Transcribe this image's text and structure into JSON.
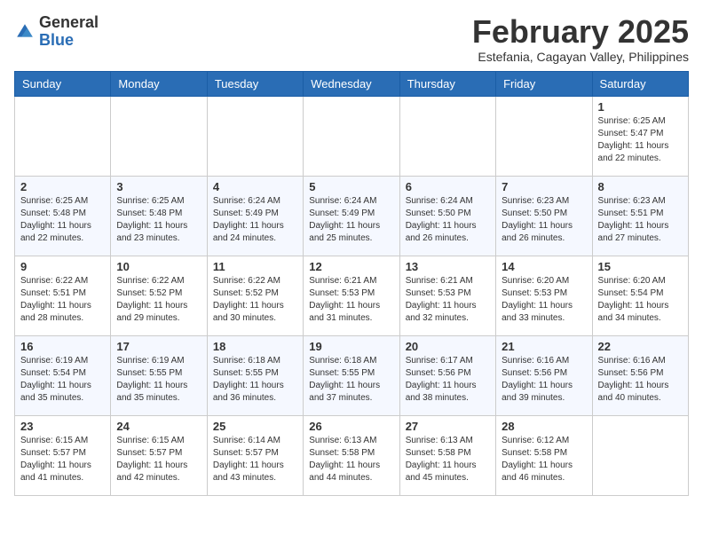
{
  "header": {
    "logo_general": "General",
    "logo_blue": "Blue",
    "month_year": "February 2025",
    "location": "Estefania, Cagayan Valley, Philippines"
  },
  "days_of_week": [
    "Sunday",
    "Monday",
    "Tuesday",
    "Wednesday",
    "Thursday",
    "Friday",
    "Saturday"
  ],
  "weeks": [
    [
      {
        "day": "",
        "info": ""
      },
      {
        "day": "",
        "info": ""
      },
      {
        "day": "",
        "info": ""
      },
      {
        "day": "",
        "info": ""
      },
      {
        "day": "",
        "info": ""
      },
      {
        "day": "",
        "info": ""
      },
      {
        "day": "1",
        "info": "Sunrise: 6:25 AM\nSunset: 5:47 PM\nDaylight: 11 hours\nand 22 minutes."
      }
    ],
    [
      {
        "day": "2",
        "info": "Sunrise: 6:25 AM\nSunset: 5:48 PM\nDaylight: 11 hours\nand 22 minutes."
      },
      {
        "day": "3",
        "info": "Sunrise: 6:25 AM\nSunset: 5:48 PM\nDaylight: 11 hours\nand 23 minutes."
      },
      {
        "day": "4",
        "info": "Sunrise: 6:24 AM\nSunset: 5:49 PM\nDaylight: 11 hours\nand 24 minutes."
      },
      {
        "day": "5",
        "info": "Sunrise: 6:24 AM\nSunset: 5:49 PM\nDaylight: 11 hours\nand 25 minutes."
      },
      {
        "day": "6",
        "info": "Sunrise: 6:24 AM\nSunset: 5:50 PM\nDaylight: 11 hours\nand 26 minutes."
      },
      {
        "day": "7",
        "info": "Sunrise: 6:23 AM\nSunset: 5:50 PM\nDaylight: 11 hours\nand 26 minutes."
      },
      {
        "day": "8",
        "info": "Sunrise: 6:23 AM\nSunset: 5:51 PM\nDaylight: 11 hours\nand 27 minutes."
      }
    ],
    [
      {
        "day": "9",
        "info": "Sunrise: 6:22 AM\nSunset: 5:51 PM\nDaylight: 11 hours\nand 28 minutes."
      },
      {
        "day": "10",
        "info": "Sunrise: 6:22 AM\nSunset: 5:52 PM\nDaylight: 11 hours\nand 29 minutes."
      },
      {
        "day": "11",
        "info": "Sunrise: 6:22 AM\nSunset: 5:52 PM\nDaylight: 11 hours\nand 30 minutes."
      },
      {
        "day": "12",
        "info": "Sunrise: 6:21 AM\nSunset: 5:53 PM\nDaylight: 11 hours\nand 31 minutes."
      },
      {
        "day": "13",
        "info": "Sunrise: 6:21 AM\nSunset: 5:53 PM\nDaylight: 11 hours\nand 32 minutes."
      },
      {
        "day": "14",
        "info": "Sunrise: 6:20 AM\nSunset: 5:53 PM\nDaylight: 11 hours\nand 33 minutes."
      },
      {
        "day": "15",
        "info": "Sunrise: 6:20 AM\nSunset: 5:54 PM\nDaylight: 11 hours\nand 34 minutes."
      }
    ],
    [
      {
        "day": "16",
        "info": "Sunrise: 6:19 AM\nSunset: 5:54 PM\nDaylight: 11 hours\nand 35 minutes."
      },
      {
        "day": "17",
        "info": "Sunrise: 6:19 AM\nSunset: 5:55 PM\nDaylight: 11 hours\nand 35 minutes."
      },
      {
        "day": "18",
        "info": "Sunrise: 6:18 AM\nSunset: 5:55 PM\nDaylight: 11 hours\nand 36 minutes."
      },
      {
        "day": "19",
        "info": "Sunrise: 6:18 AM\nSunset: 5:55 PM\nDaylight: 11 hours\nand 37 minutes."
      },
      {
        "day": "20",
        "info": "Sunrise: 6:17 AM\nSunset: 5:56 PM\nDaylight: 11 hours\nand 38 minutes."
      },
      {
        "day": "21",
        "info": "Sunrise: 6:16 AM\nSunset: 5:56 PM\nDaylight: 11 hours\nand 39 minutes."
      },
      {
        "day": "22",
        "info": "Sunrise: 6:16 AM\nSunset: 5:56 PM\nDaylight: 11 hours\nand 40 minutes."
      }
    ],
    [
      {
        "day": "23",
        "info": "Sunrise: 6:15 AM\nSunset: 5:57 PM\nDaylight: 11 hours\nand 41 minutes."
      },
      {
        "day": "24",
        "info": "Sunrise: 6:15 AM\nSunset: 5:57 PM\nDaylight: 11 hours\nand 42 minutes."
      },
      {
        "day": "25",
        "info": "Sunrise: 6:14 AM\nSunset: 5:57 PM\nDaylight: 11 hours\nand 43 minutes."
      },
      {
        "day": "26",
        "info": "Sunrise: 6:13 AM\nSunset: 5:58 PM\nDaylight: 11 hours\nand 44 minutes."
      },
      {
        "day": "27",
        "info": "Sunrise: 6:13 AM\nSunset: 5:58 PM\nDaylight: 11 hours\nand 45 minutes."
      },
      {
        "day": "28",
        "info": "Sunrise: 6:12 AM\nSunset: 5:58 PM\nDaylight: 11 hours\nand 46 minutes."
      },
      {
        "day": "",
        "info": ""
      }
    ]
  ]
}
